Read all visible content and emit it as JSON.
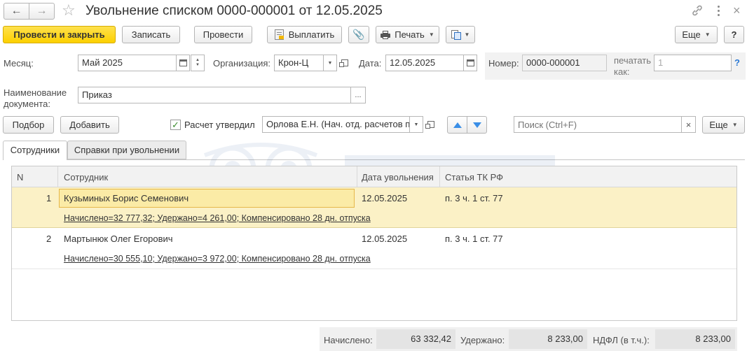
{
  "window": {
    "title": "Увольнение списком 0000-000001 от 12.05.2025",
    "link_icon": "link-icon",
    "more_icon": "more-vertical-icon",
    "close_icon": "close-icon"
  },
  "toolbar": {
    "post_close_label": "Провести и закрыть",
    "save_label": "Записать",
    "post_label": "Провести",
    "pay_label": "Выплатить",
    "print_label": "Печать",
    "more_label": "Еще",
    "help_label": "?"
  },
  "header": {
    "month_label": "Месяц:",
    "month_value": "Май 2025",
    "org_label": "Организация:",
    "org_value": "Крон-Ц",
    "date_label": "Дата:",
    "date_value": "12.05.2025",
    "number_label": "Номер:",
    "number_value": "0000-000001",
    "print_as_label_1": "печатать",
    "print_as_label_2": "как:",
    "print_as_value": "1",
    "print_as_help": "?",
    "docname_label_1": "Наименование",
    "docname_label_2": "документа:",
    "docname_value": "Приказ",
    "docname_btn": "..."
  },
  "actions": {
    "select_label": "Подбор",
    "add_label": "Добавить",
    "approved_label": "Расчет утвердил",
    "approved_checked": true,
    "approver_value": "Орлова Е.Н. (Нач. отд. расчетов п",
    "search_placeholder": "Поиск (Ctrl+F)",
    "search_clear": "×",
    "more_label": "Еще"
  },
  "tabs": [
    {
      "label": "Сотрудники",
      "active": true
    },
    {
      "label": "Справки при увольнении",
      "active": false
    }
  ],
  "table": {
    "columns": [
      "N",
      "Сотрудник",
      "Дата увольнения",
      "Статья ТК РФ"
    ],
    "rows": [
      {
        "n": "1",
        "employee": "Кузьминых Борис Семенович",
        "date": "12.05.2025",
        "article": "п. 3 ч. 1 ст. 77",
        "details": "Начислено=32 777,32; Удержано=4 261,00; Компенсировано 28 дн. отпуска",
        "selected": true
      },
      {
        "n": "2",
        "employee": "Мартынюк Олег Егорович",
        "date": "12.05.2025",
        "article": "п. 3 ч. 1 ст. 77",
        "details": "Начислено=30 555,10; Удержано=3 972,00; Компенсировано 28 дн. отпуска",
        "selected": false
      }
    ]
  },
  "totals": {
    "accrued_label": "Начислено:",
    "accrued_value": "63 332,42",
    "withheld_label": "Удержано:",
    "withheld_value": "8 233,00",
    "ndfl_label": "НДФЛ (в т.ч.):",
    "ndfl_value": "8 233,00"
  },
  "colors": {
    "primary_button": "#fcd000",
    "selected_row": "#fbf1c6",
    "selected_cell_border": "#e6b84a",
    "arrow_blue": "#3a8ee6",
    "check_green": "#3c8d2f"
  }
}
